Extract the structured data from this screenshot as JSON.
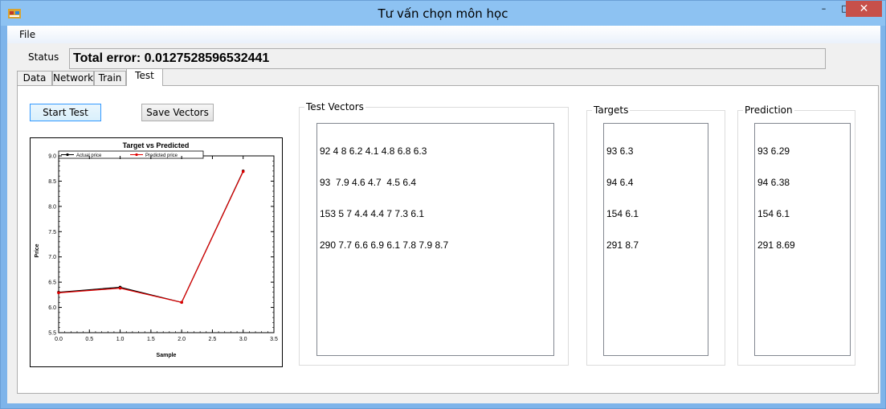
{
  "window": {
    "title": "Tư vấn chọn môn học"
  },
  "menu": {
    "file": "File"
  },
  "status": {
    "label": "Status",
    "value": "Total error: 0.0127528596532441"
  },
  "tabs": [
    "Data",
    "Network",
    "Train",
    "Test"
  ],
  "buttons": {
    "start_test": "Start Test",
    "save_vectors": "Save Vectors"
  },
  "groups": {
    "test_vectors": "Test Vectors",
    "targets": "Targets",
    "prediction": "Prediction"
  },
  "test_vectors": [
    "92 4 8 6.2 4.1 4.8 6.8 6.3",
    "93  7.9 4.6 4.7  4.5 6.4",
    "153 5 7 4.4 4.4 7 7.3 6.1",
    "290 7.7 6.6 6.9 6.1 7.8 7.9 8.7"
  ],
  "targets": [
    "93 6.3",
    "94 6.4",
    "154 6.1",
    "291 8.7"
  ],
  "predictions": [
    "93 6.29",
    "94 6.38",
    "154 6.1",
    "291 8.69"
  ],
  "chart_data": {
    "type": "line",
    "title": "Target vs Predicted",
    "xlabel": "Sample",
    "ylabel": "Price",
    "xlim": [
      0.0,
      3.5
    ],
    "ylim": [
      5.5,
      9.0
    ],
    "xticks": [
      "0.0",
      "0.5",
      "1.0",
      "1.5",
      "2.0",
      "2.5",
      "3.0",
      "3.5"
    ],
    "yticks": [
      "5.5",
      "6.0",
      "6.5",
      "7.0",
      "7.5",
      "8.0",
      "8.5",
      "9.0"
    ],
    "legend_position": "top",
    "series": [
      {
        "name": "Actual price",
        "color": "#000000",
        "x": [
          0,
          1,
          2,
          3
        ],
        "values": [
          6.3,
          6.4,
          6.1,
          8.7
        ]
      },
      {
        "name": "Predicted price",
        "color": "#e00000",
        "x": [
          0,
          1,
          2,
          3
        ],
        "values": [
          6.29,
          6.38,
          6.1,
          8.69
        ]
      }
    ]
  }
}
